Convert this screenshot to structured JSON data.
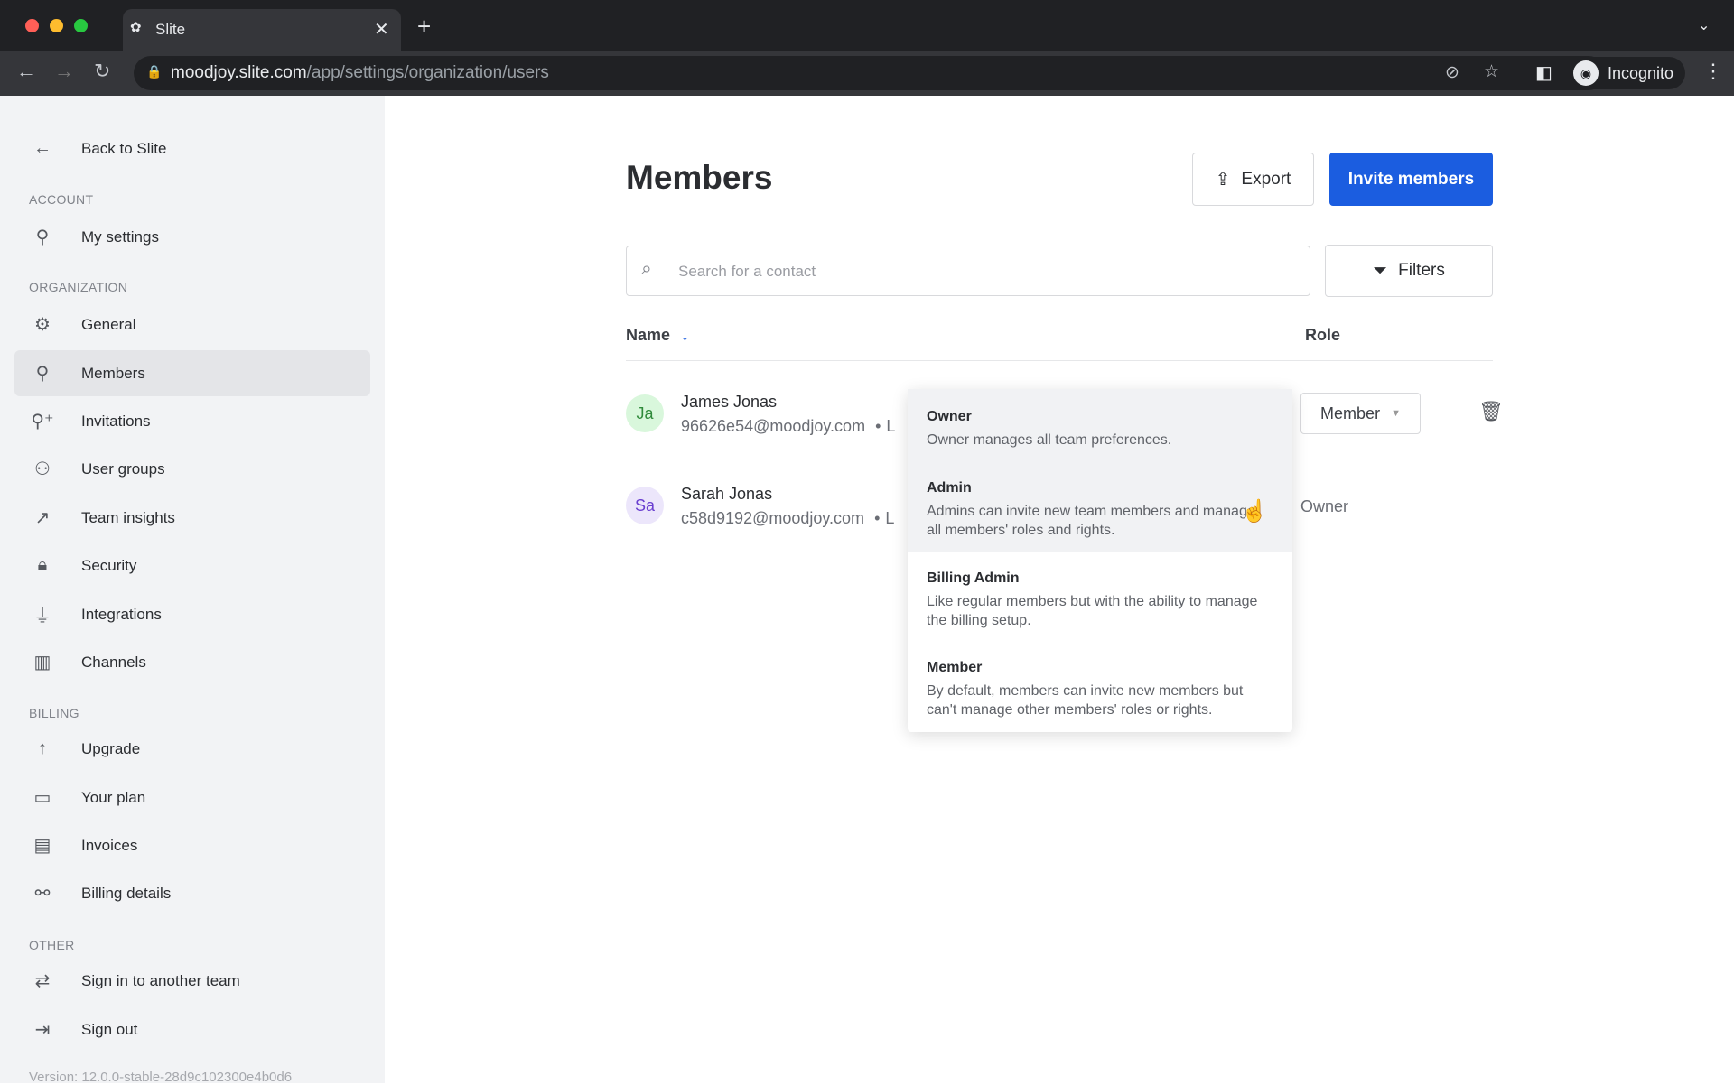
{
  "browser": {
    "tab_title": "Slite",
    "url_host": "moodjoy.slite.com",
    "url_path": "/app/settings/organization/users",
    "profile": "Incognito"
  },
  "sidebar": {
    "back": "Back to Slite",
    "sections": [
      {
        "label": "ACCOUNT",
        "items": [
          {
            "label": "My settings",
            "icon": "user-icon"
          }
        ]
      },
      {
        "label": "ORGANIZATION",
        "items": [
          {
            "label": "General",
            "icon": "gear-icon"
          },
          {
            "label": "Members",
            "icon": "user-icon",
            "active": true
          },
          {
            "label": "Invitations",
            "icon": "user-plus-icon"
          },
          {
            "label": "User groups",
            "icon": "users-icon"
          },
          {
            "label": "Team insights",
            "icon": "trend-icon"
          },
          {
            "label": "Security",
            "icon": "lock-icon"
          },
          {
            "label": "Integrations",
            "icon": "plug-icon"
          },
          {
            "label": "Channels",
            "icon": "channels-icon"
          }
        ]
      },
      {
        "label": "BILLING",
        "items": [
          {
            "label": "Upgrade",
            "icon": "arrow-up-icon"
          },
          {
            "label": "Your plan",
            "icon": "card-icon"
          },
          {
            "label": "Invoices",
            "icon": "invoice-icon"
          },
          {
            "label": "Billing details",
            "icon": "paperclip-icon"
          }
        ]
      },
      {
        "label": "OTHER",
        "items": [
          {
            "label": "Sign in to another team",
            "icon": "switch-icon"
          },
          {
            "label": "Sign out",
            "icon": "sign-out-icon"
          }
        ]
      }
    ],
    "version": "Version: 12.0.0-stable-28d9c102300e4b0d6"
  },
  "main": {
    "title": "Members",
    "export": "Export",
    "invite": "Invite members",
    "search_placeholder": "Search for a contact",
    "filters": "Filters",
    "col_name": "Name",
    "col_role": "Role",
    "rows": [
      {
        "initials": "Ja",
        "name": "James Jonas",
        "email": "96626e54@moodjoy.com",
        "sep": "•",
        "trail": "L",
        "role": "Member"
      },
      {
        "initials": "Sa",
        "name": "Sarah Jonas",
        "email": "c58d9192@moodjoy.com",
        "sep": "•",
        "trail": "L",
        "role": "Owner"
      }
    ]
  },
  "dropdown": [
    {
      "title": "Owner",
      "desc": "Owner manages all team preferences."
    },
    {
      "title": "Admin",
      "desc": "Admins can invite new team members and manage all members' roles and rights."
    },
    {
      "title": "Billing Admin",
      "desc": "Like regular members but with the ability to manage the billing setup."
    },
    {
      "title": "Member",
      "desc": "By default, members can invite new members but can't manage other members' roles or rights."
    }
  ],
  "colors": {
    "accent": "#1b5de0",
    "sidebar_bg": "#f2f3f5",
    "avatar_ja": "#d9f7dc",
    "avatar_sa": "#ece6fb"
  }
}
